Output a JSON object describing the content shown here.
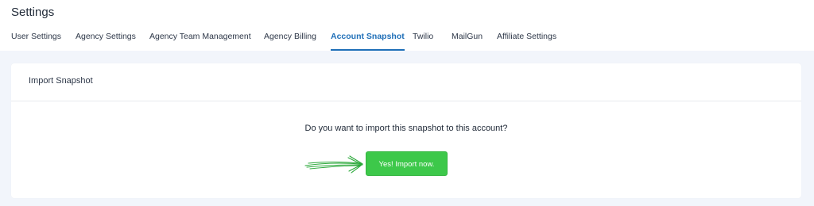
{
  "header": {
    "title": "Settings"
  },
  "tabs": [
    {
      "label": "User Settings"
    },
    {
      "label": "Agency Settings"
    },
    {
      "label": "Agency Team Management"
    },
    {
      "label": "Agency Billing"
    },
    {
      "label": "Account Snapshot"
    },
    {
      "label": "Twilio"
    },
    {
      "label": "MailGun"
    },
    {
      "label": "Affiliate Settings"
    }
  ],
  "card": {
    "title": "Import Snapshot",
    "question": "Do you want to import this snapshot to this account?",
    "button_label": "Yes! Import now."
  },
  "colors": {
    "accent": "#1f6fb8",
    "primary_button": "#3dc84a",
    "background": "#f2f5fb"
  },
  "icons": {
    "arrow": "hand-drawn-arrow-icon"
  }
}
